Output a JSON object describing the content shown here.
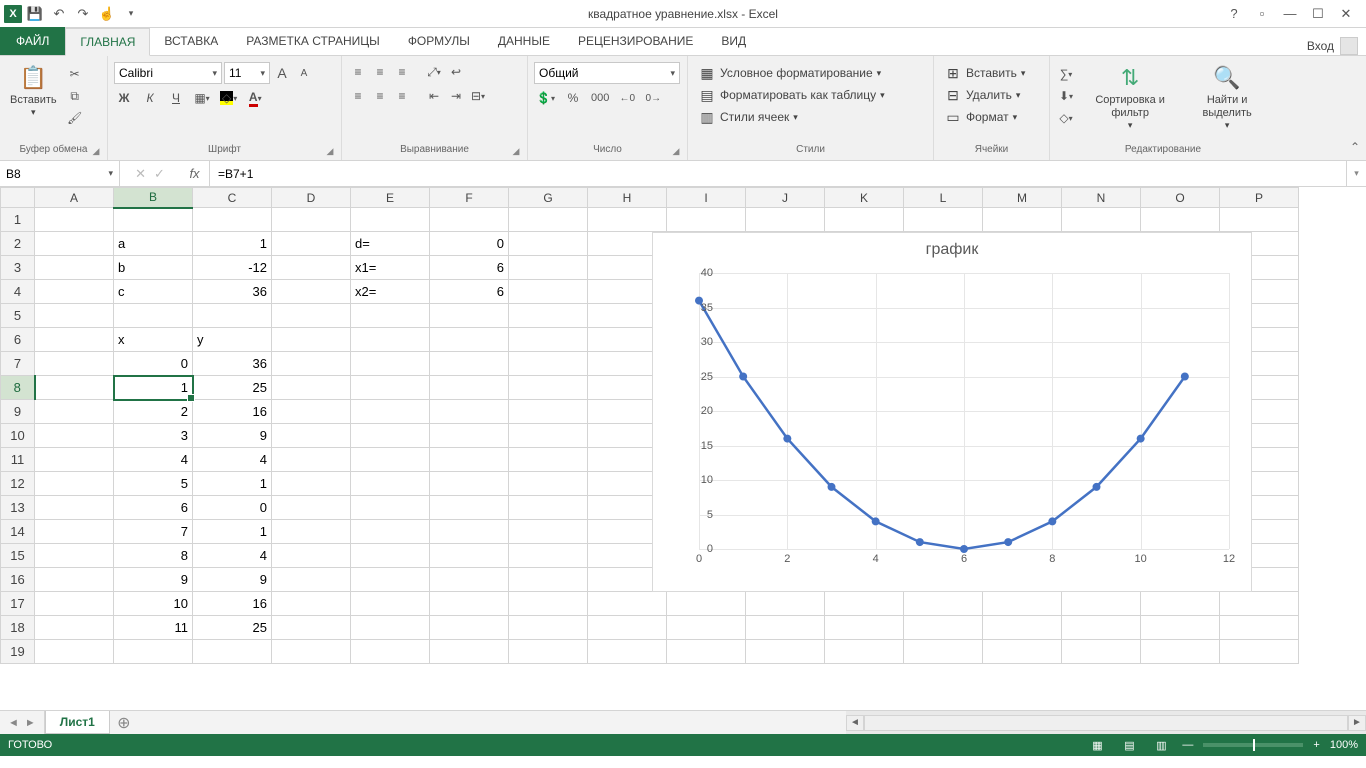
{
  "title": "квадратное уравнение.xlsx - Excel",
  "login_label": "Вход",
  "tabs": {
    "file": "ФАЙЛ",
    "items": [
      "ГЛАВНАЯ",
      "ВСТАВКА",
      "РАЗМЕТКА СТРАНИЦЫ",
      "ФОРМУЛЫ",
      "ДАННЫЕ",
      "РЕЦЕНЗИРОВАНИЕ",
      "ВИД"
    ],
    "active_index": 0
  },
  "ribbon": {
    "clipboard": {
      "paste": "Вставить",
      "label": "Буфер обмена"
    },
    "font": {
      "name": "Calibri",
      "size": "11",
      "label": "Шрифт",
      "bold": "Ж",
      "italic": "К",
      "underline": "Ч"
    },
    "align": {
      "label": "Выравнивание"
    },
    "number": {
      "format": "Общий",
      "label": "Число"
    },
    "styles": {
      "cond": "Условное форматирование",
      "table": "Форматировать как таблицу",
      "cell": "Стили ячеек",
      "label": "Стили"
    },
    "cells": {
      "insert": "Вставить",
      "delete": "Удалить",
      "format": "Формат",
      "label": "Ячейки"
    },
    "editing": {
      "sort": "Сортировка и фильтр",
      "find": "Найти и выделить",
      "label": "Редактирование"
    }
  },
  "namebox": "B8",
  "formula": "=B7+1",
  "columns": [
    "A",
    "B",
    "C",
    "D",
    "E",
    "F",
    "G",
    "H",
    "I",
    "J",
    "K",
    "L",
    "M",
    "N",
    "O",
    "P"
  ],
  "selected_col_index": 1,
  "selected_row": 8,
  "cells": {
    "B2": {
      "v": "a",
      "t": "txt"
    },
    "C2": {
      "v": "1",
      "t": "num"
    },
    "E2": {
      "v": "d=",
      "t": "txt"
    },
    "F2": {
      "v": "0",
      "t": "num"
    },
    "B3": {
      "v": "b",
      "t": "txt"
    },
    "C3": {
      "v": "-12",
      "t": "num"
    },
    "E3": {
      "v": "x1=",
      "t": "txt"
    },
    "F3": {
      "v": "6",
      "t": "num"
    },
    "B4": {
      "v": "c",
      "t": "txt"
    },
    "C4": {
      "v": "36",
      "t": "num"
    },
    "E4": {
      "v": "x2=",
      "t": "txt"
    },
    "F4": {
      "v": "6",
      "t": "num"
    },
    "B6": {
      "v": "x",
      "t": "txt"
    },
    "C6": {
      "v": "y",
      "t": "txt"
    },
    "B7": {
      "v": "0",
      "t": "num"
    },
    "C7": {
      "v": "36",
      "t": "num"
    },
    "B8": {
      "v": "1",
      "t": "num"
    },
    "C8": {
      "v": "25",
      "t": "num"
    },
    "B9": {
      "v": "2",
      "t": "num"
    },
    "C9": {
      "v": "16",
      "t": "num"
    },
    "B10": {
      "v": "3",
      "t": "num"
    },
    "C10": {
      "v": "9",
      "t": "num"
    },
    "B11": {
      "v": "4",
      "t": "num"
    },
    "C11": {
      "v": "4",
      "t": "num"
    },
    "B12": {
      "v": "5",
      "t": "num"
    },
    "C12": {
      "v": "1",
      "t": "num"
    },
    "B13": {
      "v": "6",
      "t": "num"
    },
    "C13": {
      "v": "0",
      "t": "num"
    },
    "B14": {
      "v": "7",
      "t": "num"
    },
    "C14": {
      "v": "1",
      "t": "num"
    },
    "B15": {
      "v": "8",
      "t": "num"
    },
    "C15": {
      "v": "4",
      "t": "num"
    },
    "B16": {
      "v": "9",
      "t": "num"
    },
    "C16": {
      "v": "9",
      "t": "num"
    },
    "B17": {
      "v": "10",
      "t": "num"
    },
    "C17": {
      "v": "16",
      "t": "num"
    },
    "B18": {
      "v": "11",
      "t": "num"
    },
    "C18": {
      "v": "25",
      "t": "num"
    }
  },
  "row_count": 19,
  "chart_data": {
    "type": "line",
    "title": "график",
    "x": [
      0,
      1,
      2,
      3,
      4,
      5,
      6,
      7,
      8,
      9,
      10,
      11
    ],
    "series": [
      {
        "name": "y",
        "values": [
          36,
          25,
          16,
          9,
          4,
          1,
          0,
          1,
          4,
          9,
          16,
          25
        ],
        "color": "#4472c4"
      }
    ],
    "y_ticks": [
      0,
      5,
      10,
      15,
      20,
      25,
      30,
      35,
      40
    ],
    "x_ticks": [
      0,
      2,
      4,
      6,
      8,
      10,
      12
    ],
    "xlim": [
      0,
      12
    ],
    "ylim": [
      0,
      40
    ]
  },
  "sheet": "Лист1",
  "status_text": "ГОТОВО",
  "zoom": "100%"
}
